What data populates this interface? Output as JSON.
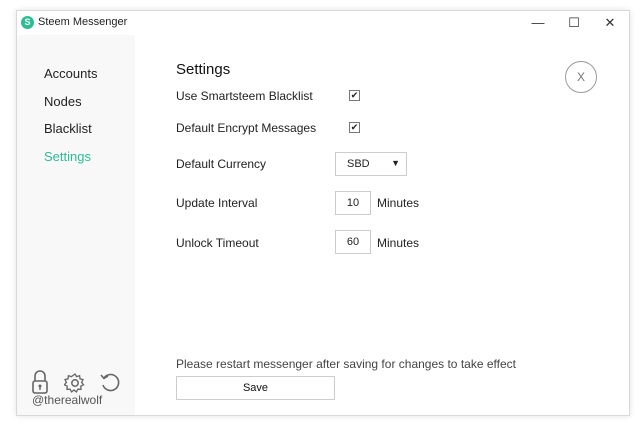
{
  "window": {
    "title": "Steem Messenger",
    "app_icon": "steem-logo-icon",
    "controls": {
      "minimize": "—",
      "maximize": "☐",
      "close": "✕"
    }
  },
  "sidebar": {
    "items": [
      {
        "label": "Accounts",
        "active": false
      },
      {
        "label": "Nodes",
        "active": false
      },
      {
        "label": "Blacklist",
        "active": false
      },
      {
        "label": "Settings",
        "active": true
      }
    ],
    "accent_color": "#2bbd94",
    "icons": [
      "lock-icon",
      "gear-icon",
      "refresh-icon"
    ],
    "username": "@therealwolf"
  },
  "settings": {
    "title": "Settings",
    "close_label": "X",
    "use_blacklist": {
      "label": "Use Smartsteem Blacklist",
      "checked": true,
      "mark": "✔"
    },
    "encrypt": {
      "label": "Default Encrypt Messages",
      "checked": true,
      "mark": "✔"
    },
    "currency": {
      "label": "Default Currency",
      "value": "SBD",
      "arrow": "▼"
    },
    "update_interval": {
      "label": "Update Interval",
      "value": "10",
      "unit": "Minutes"
    },
    "unlock_timeout": {
      "label": "Unlock Timeout",
      "value": "60",
      "unit": "Minutes"
    },
    "notice": "Please restart messenger after saving for changes to take effect",
    "save_label": "Save"
  }
}
